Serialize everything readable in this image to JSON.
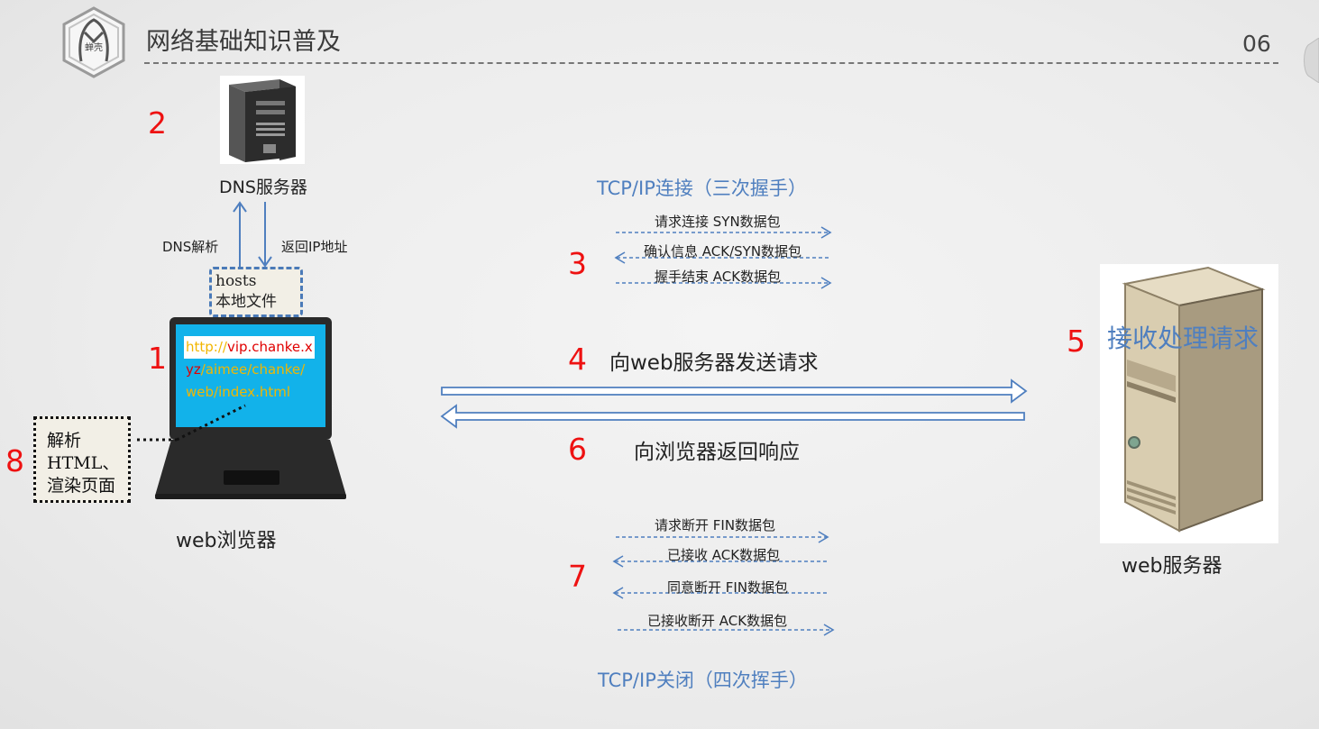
{
  "header": {
    "title": "网络基础知识普及",
    "page_number": "06",
    "logo_text": "蝉壳"
  },
  "dns": {
    "server_label": "DNS服务器",
    "resolve_label": "DNS解析",
    "return_ip_label": "返回IP地址"
  },
  "hosts": {
    "line1": "hosts",
    "line2": "本地文件"
  },
  "browser": {
    "url_line1_scheme": "http://",
    "url_line1_host": "vip.chanke.x",
    "url_line2_host": "yz",
    "url_line2_path": "/aimee/chanke/",
    "url_line3": "web/index.html",
    "label": "web浏览器"
  },
  "parse": {
    "line1": "解析",
    "line2": "HTML、",
    "line3": "渲染页面"
  },
  "steps": [
    "1",
    "2",
    "3",
    "4",
    "5",
    "6",
    "7",
    "8"
  ],
  "handshake": {
    "title": "TCP/IP连接（三次握手）",
    "packets": [
      "请求连接 SYN数据包",
      "确认信息 ACK/SYN数据包",
      "握手结束 ACK数据包"
    ]
  },
  "request": {
    "label": "向web服务器发送请求"
  },
  "response": {
    "label": "向浏览器返回响应"
  },
  "teardown": {
    "title": "TCP/IP关闭（四次挥手）",
    "packets": [
      "请求断开 FIN数据包",
      "已接收 ACK数据包",
      "同意断开 FIN数据包",
      "已接收断开 ACK数据包"
    ]
  },
  "web_server": {
    "receive_label": "接收处理请求",
    "label": "web服务器"
  },
  "colors": {
    "accent_blue": "#4f7fbf",
    "step_red": "#ee1111",
    "url_yellow": "#f2b600",
    "url_red": "#e00000",
    "screen_blue": "#12b2ea"
  }
}
